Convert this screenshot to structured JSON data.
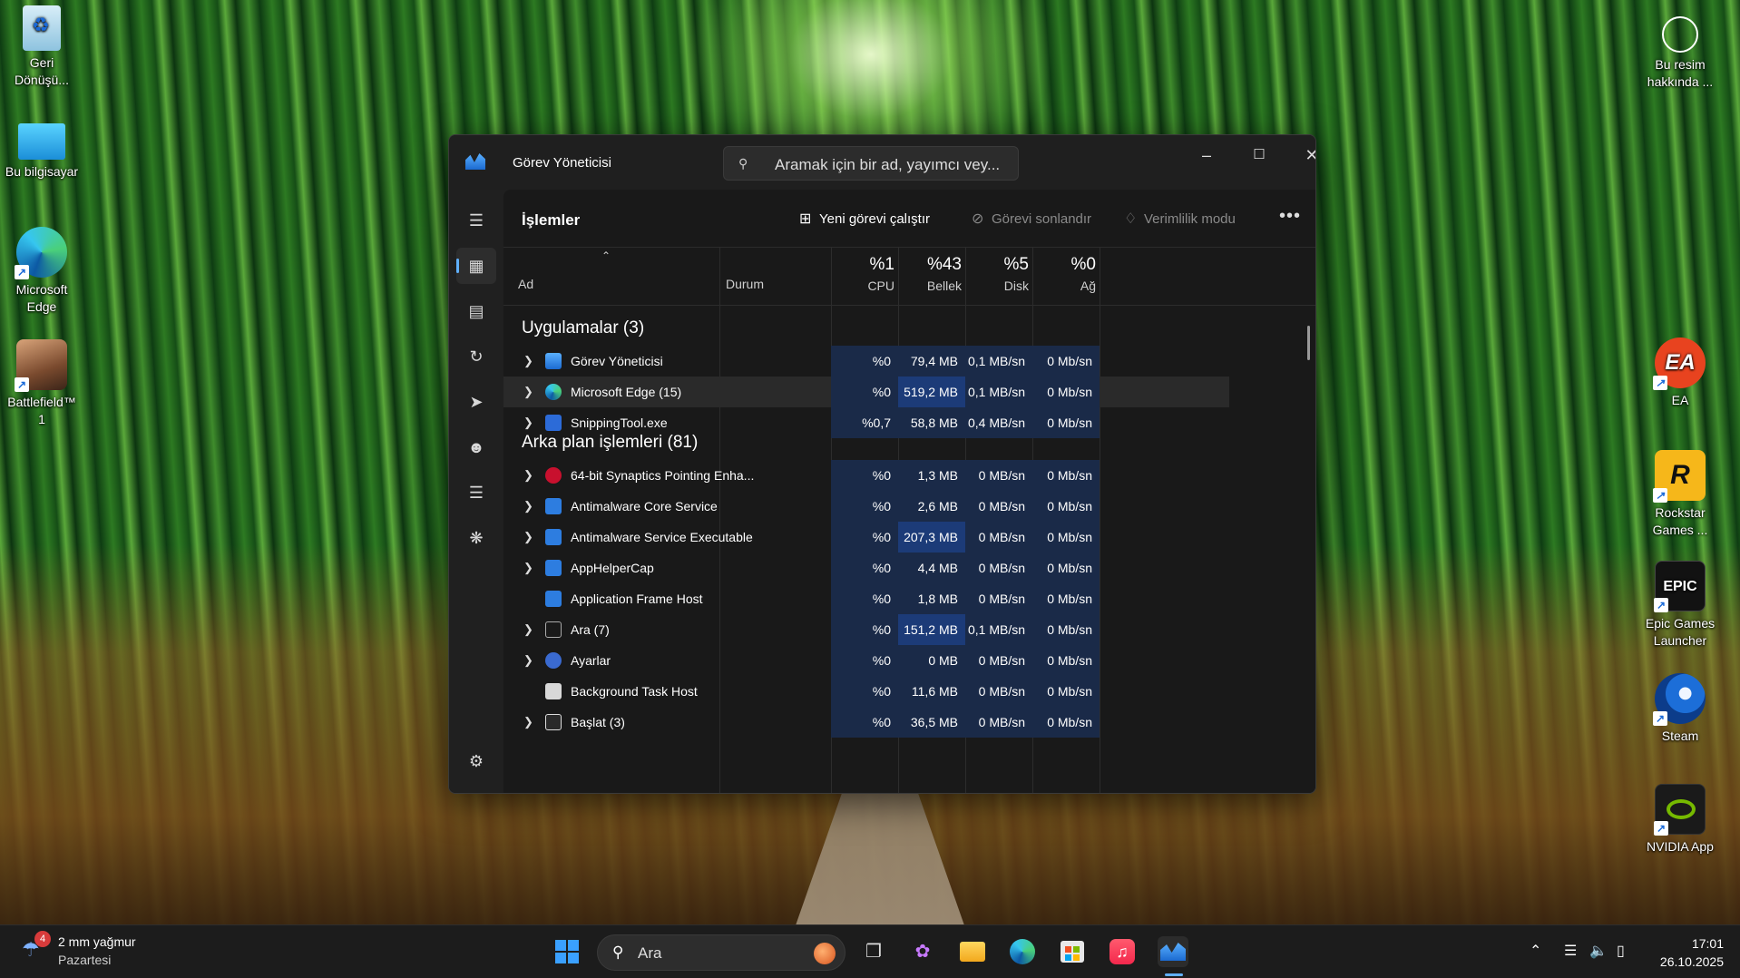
{
  "desktop": {
    "left_icons": [
      {
        "label": "Geri\nDönüşü...",
        "icon": "recycle-bin-icon"
      },
      {
        "label": "Bu bilgisayar",
        "icon": "computer-icon"
      },
      {
        "label": "Microsoft\nEdge",
        "icon": "edge-icon"
      },
      {
        "label": "Battlefield™\n1",
        "icon": "battlefield-icon"
      }
    ],
    "right_icons": [
      {
        "label": "Bu resim\nhakkında ...",
        "icon": "image-info-icon"
      },
      {
        "label": "EA",
        "icon": "ea-icon"
      },
      {
        "label": "Rockstar\nGames ...",
        "icon": "rockstar-icon"
      },
      {
        "label": "Epic Games\nLauncher",
        "icon": "epic-games-icon"
      },
      {
        "label": "Steam",
        "icon": "steam-icon"
      },
      {
        "label": "NVIDIA App",
        "icon": "nvidia-icon"
      }
    ]
  },
  "window": {
    "title": "Görev Yöneticisi",
    "search_placeholder": "Aramak için bir ad, yayımcı vey...",
    "page_title": "İşlemler",
    "toolbar": {
      "run_new_task": "Yeni görevi çalıştır",
      "end_task": "Görevi sonlandır",
      "efficiency_mode": "Verimlilik modu",
      "more": "•••"
    },
    "columns": {
      "name": "Ad",
      "status": "Durum",
      "cpu": {
        "pct": "%1",
        "label": "CPU"
      },
      "memory": {
        "pct": "%43",
        "label": "Bellek"
      },
      "disk": {
        "pct": "%5",
        "label": "Disk"
      },
      "network": {
        "pct": "%0",
        "label": "Ağ"
      }
    },
    "groups": {
      "apps": "Uygulamalar (3)",
      "background": "Arka plan işlemleri (81)"
    },
    "apps": [
      {
        "name": "Görev Yöneticisi",
        "cpu": "%0",
        "mem": "79,4 MB",
        "disk": "0,1 MB/sn",
        "net": "0 Mb/sn",
        "expandable": true,
        "status": ""
      },
      {
        "name": "Microsoft Edge (15)",
        "cpu": "%0",
        "mem": "519,2 MB",
        "disk": "0,1 MB/sn",
        "net": "0 Mb/sn",
        "expandable": true,
        "status": "efficiency"
      },
      {
        "name": "SnippingTool.exe",
        "cpu": "%0,7",
        "mem": "58,8 MB",
        "disk": "0,4 MB/sn",
        "net": "0 Mb/sn",
        "expandable": true,
        "status": ""
      }
    ],
    "background": [
      {
        "name": "64-bit Synaptics Pointing Enha...",
        "cpu": "%0",
        "mem": "1,3 MB",
        "disk": "0 MB/sn",
        "net": "0 Mb/sn",
        "expandable": true,
        "status": ""
      },
      {
        "name": "Antimalware Core Service",
        "cpu": "%0",
        "mem": "2,6 MB",
        "disk": "0 MB/sn",
        "net": "0 Mb/sn",
        "expandable": true,
        "status": ""
      },
      {
        "name": "Antimalware Service Executable",
        "cpu": "%0",
        "mem": "207,3 MB",
        "disk": "0 MB/sn",
        "net": "0 Mb/sn",
        "expandable": true,
        "status": ""
      },
      {
        "name": "AppHelperCap",
        "cpu": "%0",
        "mem": "4,4 MB",
        "disk": "0 MB/sn",
        "net": "0 Mb/sn",
        "expandable": true,
        "status": ""
      },
      {
        "name": "Application Frame Host",
        "cpu": "%0",
        "mem": "1,8 MB",
        "disk": "0 MB/sn",
        "net": "0 Mb/sn",
        "expandable": false,
        "status": ""
      },
      {
        "name": "Ara (7)",
        "cpu": "%0",
        "mem": "151,2 MB",
        "disk": "0,1 MB/sn",
        "net": "0 Mb/sn",
        "expandable": true,
        "status": ""
      },
      {
        "name": "Ayarlar",
        "cpu": "%0",
        "mem": "0 MB",
        "disk": "0 MB/sn",
        "net": "0 Mb/sn",
        "expandable": true,
        "status": "paused"
      },
      {
        "name": "Background Task Host",
        "cpu": "%0",
        "mem": "11,6 MB",
        "disk": "0 MB/sn",
        "net": "0 Mb/sn",
        "expandable": false,
        "status": ""
      },
      {
        "name": "Başlat (3)",
        "cpu": "%0",
        "mem": "36,5 MB",
        "disk": "0 MB/sn",
        "net": "0 Mb/sn",
        "expandable": true,
        "status": "paused"
      }
    ]
  },
  "taskbar": {
    "weather": {
      "badge": "4",
      "line1": "2 mm yağmur",
      "line2": "Pazartesi"
    },
    "search_label": "Ara",
    "time": "17:01",
    "date": "26.10.2025"
  },
  "colors": {
    "accent": "#60b0ff",
    "heat_low": "#1a2a48",
    "heat_high": "#1c3b78",
    "window_bg": "#202020"
  }
}
